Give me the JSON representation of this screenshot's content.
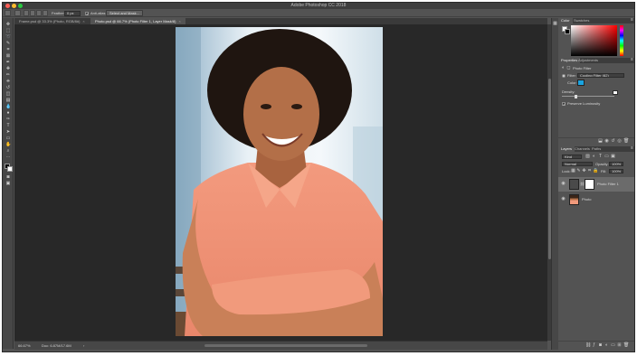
{
  "app": {
    "title": "Adobe Photoshop CC 2018",
    "window_controls": [
      "#ff5f57",
      "#febc2e",
      "#28c840"
    ]
  },
  "options_bar": {
    "feather_label": "Feather:",
    "feather_value": "0 px",
    "anti_alias_label": "Anti-alias",
    "anti_alias_checked": true,
    "select_mask_label": "Select and Mask..."
  },
  "tabs": [
    {
      "label": "Frame.psd @ 33.3% (Photo, RGB/8#)",
      "active": false
    },
    {
      "label": "Photo.psd @ 66.7% (Photo Filter 1, Layer Mask/8)",
      "active": true
    }
  ],
  "status": {
    "zoom": "66.67%",
    "doc": "Doc: 6.87M/17.6M"
  },
  "color_panel": {
    "tabs": [
      "Color",
      "Swatches"
    ]
  },
  "properties_panel": {
    "tabs": [
      "Properties",
      "Adjustments"
    ],
    "heading": "Photo Filter",
    "filter_label": "Filter:",
    "filter_value": "Cooling Filter (82)",
    "color_label": "Color:",
    "color_value": "#1aa3e0",
    "density_label": "Density:",
    "density_value": 0.25,
    "preserve_label": "Preserve Luminosity",
    "preserve_checked": true
  },
  "layers_panel": {
    "tabs": [
      "Layers",
      "Channels",
      "Paths"
    ],
    "kind_label": "Kind",
    "blend_mode": "Normal",
    "opacity_label": "Opacity:",
    "opacity_value": "100%",
    "lock_label": "Lock:",
    "fill_label": "Fill:",
    "fill_value": "100%",
    "layers": [
      {
        "name": "Photo Filter 1",
        "type": "adjustment",
        "selected": true
      },
      {
        "name": "Photo",
        "type": "image",
        "selected": false
      }
    ]
  },
  "theme": {
    "accent": "#1aa3e0",
    "background": "#535353",
    "canvas": "#282828"
  }
}
